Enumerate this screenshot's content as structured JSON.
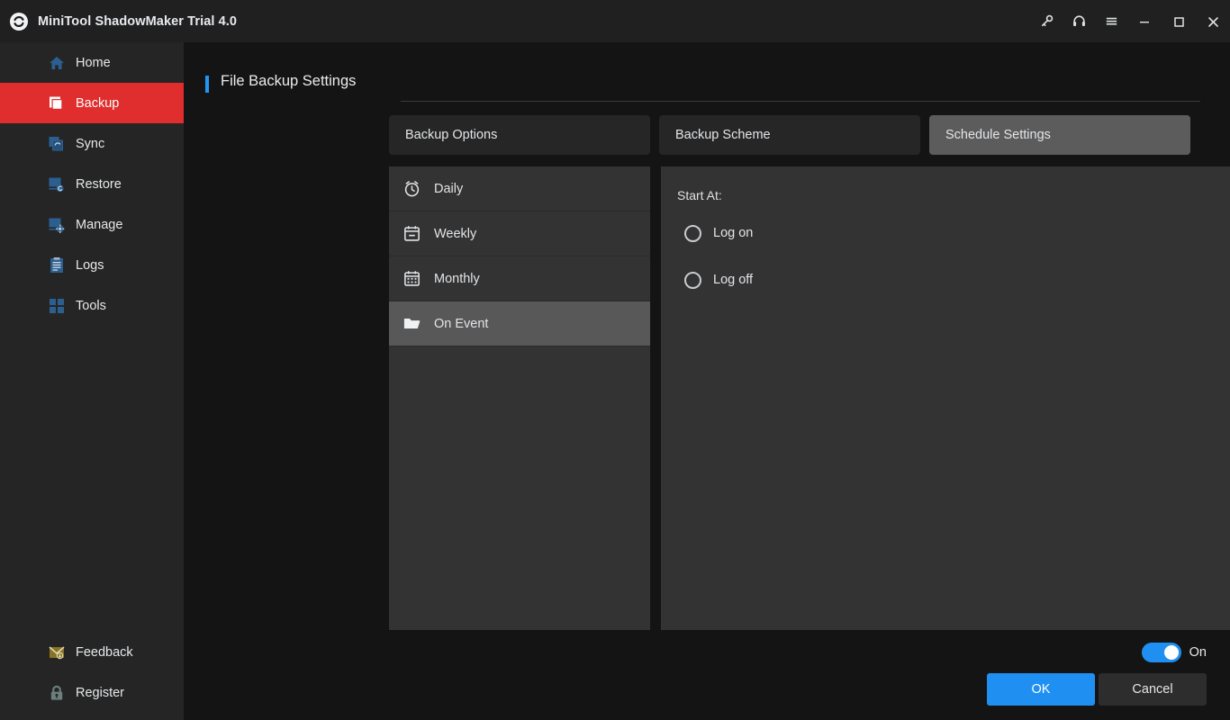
{
  "window": {
    "title": "MiniTool ShadowMaker Trial 4.0",
    "logo_icon": "shadowmaker-logo-icon",
    "controls": [
      {
        "name": "key-icon",
        "label": "Key"
      },
      {
        "name": "headset-icon",
        "label": "Support"
      },
      {
        "name": "menu-icon",
        "label": "Menu"
      },
      {
        "name": "minimize-icon",
        "label": "Minimize"
      },
      {
        "name": "maximize-icon",
        "label": "Maximize"
      },
      {
        "name": "close-icon",
        "label": "Close"
      }
    ]
  },
  "sidebar": {
    "items": [
      {
        "label": "Home",
        "icon": "home-icon",
        "active": false
      },
      {
        "label": "Backup",
        "icon": "backup-icon",
        "active": true
      },
      {
        "label": "Sync",
        "icon": "sync-icon",
        "active": false
      },
      {
        "label": "Restore",
        "icon": "restore-icon",
        "active": false
      },
      {
        "label": "Manage",
        "icon": "manage-icon",
        "active": false
      },
      {
        "label": "Logs",
        "icon": "logs-icon",
        "active": false
      },
      {
        "label": "Tools",
        "icon": "tools-icon",
        "active": false
      }
    ],
    "bottom_items": [
      {
        "label": "Feedback",
        "icon": "envelope-icon"
      },
      {
        "label": "Register",
        "icon": "lock-icon"
      }
    ],
    "active_color": "#e02d2d",
    "icon_color": "#2c5f8f"
  },
  "main": {
    "page_title": "File Backup Settings",
    "accent_color": "#2196f3",
    "tabs": [
      {
        "label": "Backup Options",
        "active": false
      },
      {
        "label": "Backup Scheme",
        "active": false
      },
      {
        "label": "Schedule Settings",
        "active": true
      }
    ],
    "schedule_list": [
      {
        "label": "Daily",
        "icon": "alarm-clock-icon",
        "selected": false
      },
      {
        "label": "Weekly",
        "icon": "calendar-icon",
        "selected": false
      },
      {
        "label": "Monthly",
        "icon": "calendar-month-icon",
        "selected": false
      },
      {
        "label": "On Event",
        "icon": "folder-icon",
        "selected": true
      }
    ],
    "detail": {
      "start_at_label": "Start At:",
      "options": [
        {
          "label": "Log on",
          "selected": false
        },
        {
          "label": "Log off",
          "selected": false
        }
      ]
    }
  },
  "footer": {
    "toggle_state": "On",
    "toggle_on": true,
    "ok_label": "OK",
    "cancel_label": "Cancel",
    "primary_color": "#1f90f2"
  }
}
